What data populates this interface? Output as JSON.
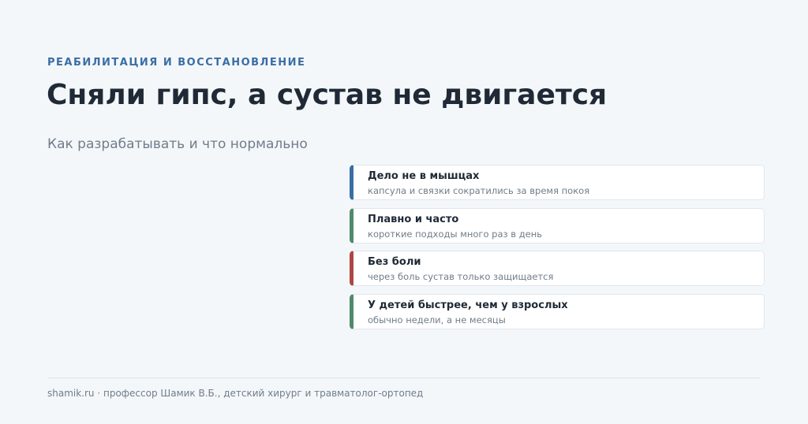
{
  "header": {
    "eyebrow": "РЕАБИЛИТАЦИЯ И ВОССТАНОВЛЕНИЕ",
    "title": "Сняли гипс, а сустав не двигается",
    "subtitle": "Как разрабатывать и что нормально"
  },
  "cards": [
    {
      "title": "Дело не в мышцах",
      "text": "капсула и связки сократились за время покоя",
      "accent": "#3a6ea5"
    },
    {
      "title": "Плавно и часто",
      "text": "короткие подходы много раз в день",
      "accent": "#4f8a6b"
    },
    {
      "title": "Без боли",
      "text": "через боль сустав только защищается",
      "accent": "#b04545"
    },
    {
      "title": "У детей быстрее, чем у взрослых",
      "text": "обычно недели, а не месяцы",
      "accent": "#4f8a6b"
    }
  ],
  "footer": {
    "text": "shamik.ru · профессор Шамик В.Б., детский хирург и травматолог-ортопед"
  }
}
